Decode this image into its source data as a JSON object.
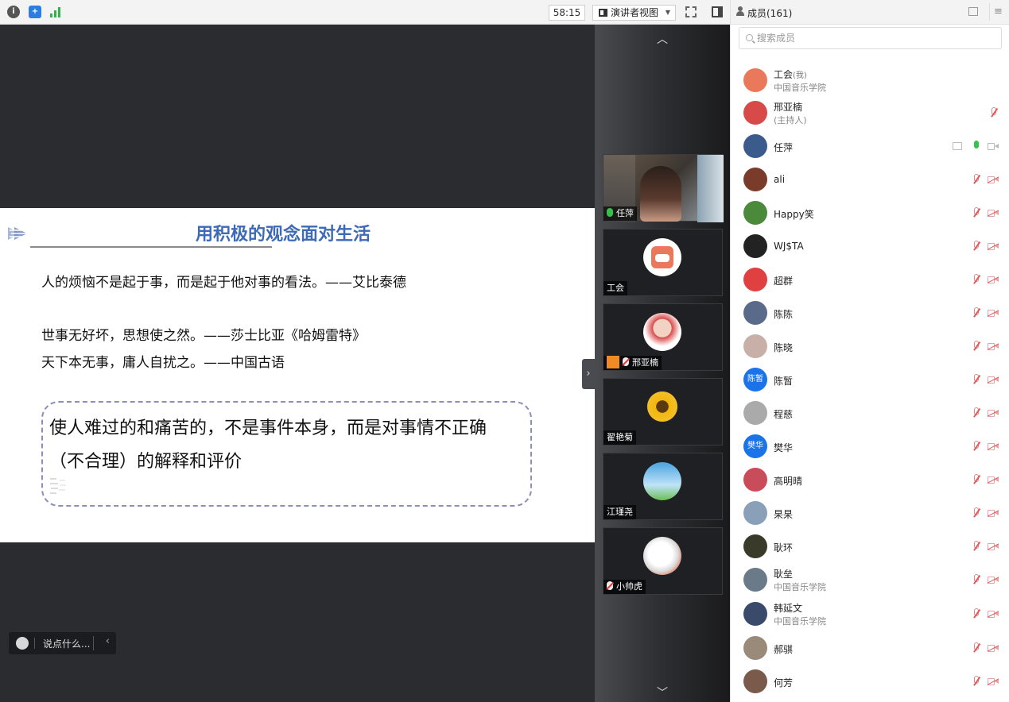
{
  "topbar": {
    "timer": "58:15",
    "view_label": "演讲者视图",
    "icons": [
      "info-icon",
      "shield-icon",
      "signal-icon",
      "fullscreen-icon",
      "layout-icon"
    ]
  },
  "slide": {
    "title": "用积极的观念面对生活",
    "lines": [
      "人的烦恼不是起于事，而是起于他对事的看法。——艾比泰德",
      "世事无好坏，思想使之然。——莎士比亚《哈姆雷特》",
      "天下本无事，庸人自扰之。——中国古语"
    ],
    "box_line1": "使人难过的和痛苦的，不是事件本身，而是对事情不正确",
    "box_line2": "（不合理）的解释和评价"
  },
  "chat": {
    "placeholder": "说点什么..."
  },
  "video_tiles": [
    {
      "name": "任萍",
      "mic": "on"
    },
    {
      "name": "工会",
      "mic": "none"
    },
    {
      "name": "邢亚楠",
      "mic": "off",
      "host": true
    },
    {
      "name": "翟艳菊",
      "mic": "none"
    },
    {
      "name": "江瑾尧",
      "mic": "none"
    },
    {
      "name": "小帅虎",
      "mic": "off"
    }
  ],
  "members_panel": {
    "title": "成员(161)",
    "search_placeholder": "搜索成员",
    "members": [
      {
        "name": "工会",
        "tag": "(我)",
        "sub": "中国音乐学院",
        "color": "#e9795a"
      },
      {
        "name": "邢亚楠",
        "sub": "(主持人)",
        "color": "#d84a4a"
      },
      {
        "name": "任萍",
        "color": "#3a5b8c",
        "mic": "on"
      },
      {
        "name": "ali",
        "color": "#7a3b2a"
      },
      {
        "name": "Happy笑",
        "color": "#4a8a3a"
      },
      {
        "name": "WJ$TA",
        "color": "#222222"
      },
      {
        "name": "超群",
        "color": "#e04040"
      },
      {
        "name": "陈陈",
        "color": "#5a6a8a"
      },
      {
        "name": "陈晓",
        "color": "#c8b0a8"
      },
      {
        "name": "陈暂",
        "color": "#1a73e8",
        "text_avatar": "陈暂"
      },
      {
        "name": "程慈",
        "color": "#aaaaaa"
      },
      {
        "name": "樊华",
        "color": "#1a73e8",
        "text_avatar": "樊华"
      },
      {
        "name": "高明晴",
        "color": "#c94c5a"
      },
      {
        "name": "杲杲",
        "color": "#8aa0b8"
      },
      {
        "name": "耿环",
        "color": "#3a3a2a"
      },
      {
        "name": "耿垒",
        "sub": "中国音乐学院",
        "color": "#6a7a88"
      },
      {
        "name": "韩延文",
        "sub": "中国音乐学院",
        "color": "#3a4a6a"
      },
      {
        "name": "郝骐",
        "color": "#9a8a7a"
      },
      {
        "name": "何芳",
        "color": "#7a5a4a"
      }
    ]
  }
}
